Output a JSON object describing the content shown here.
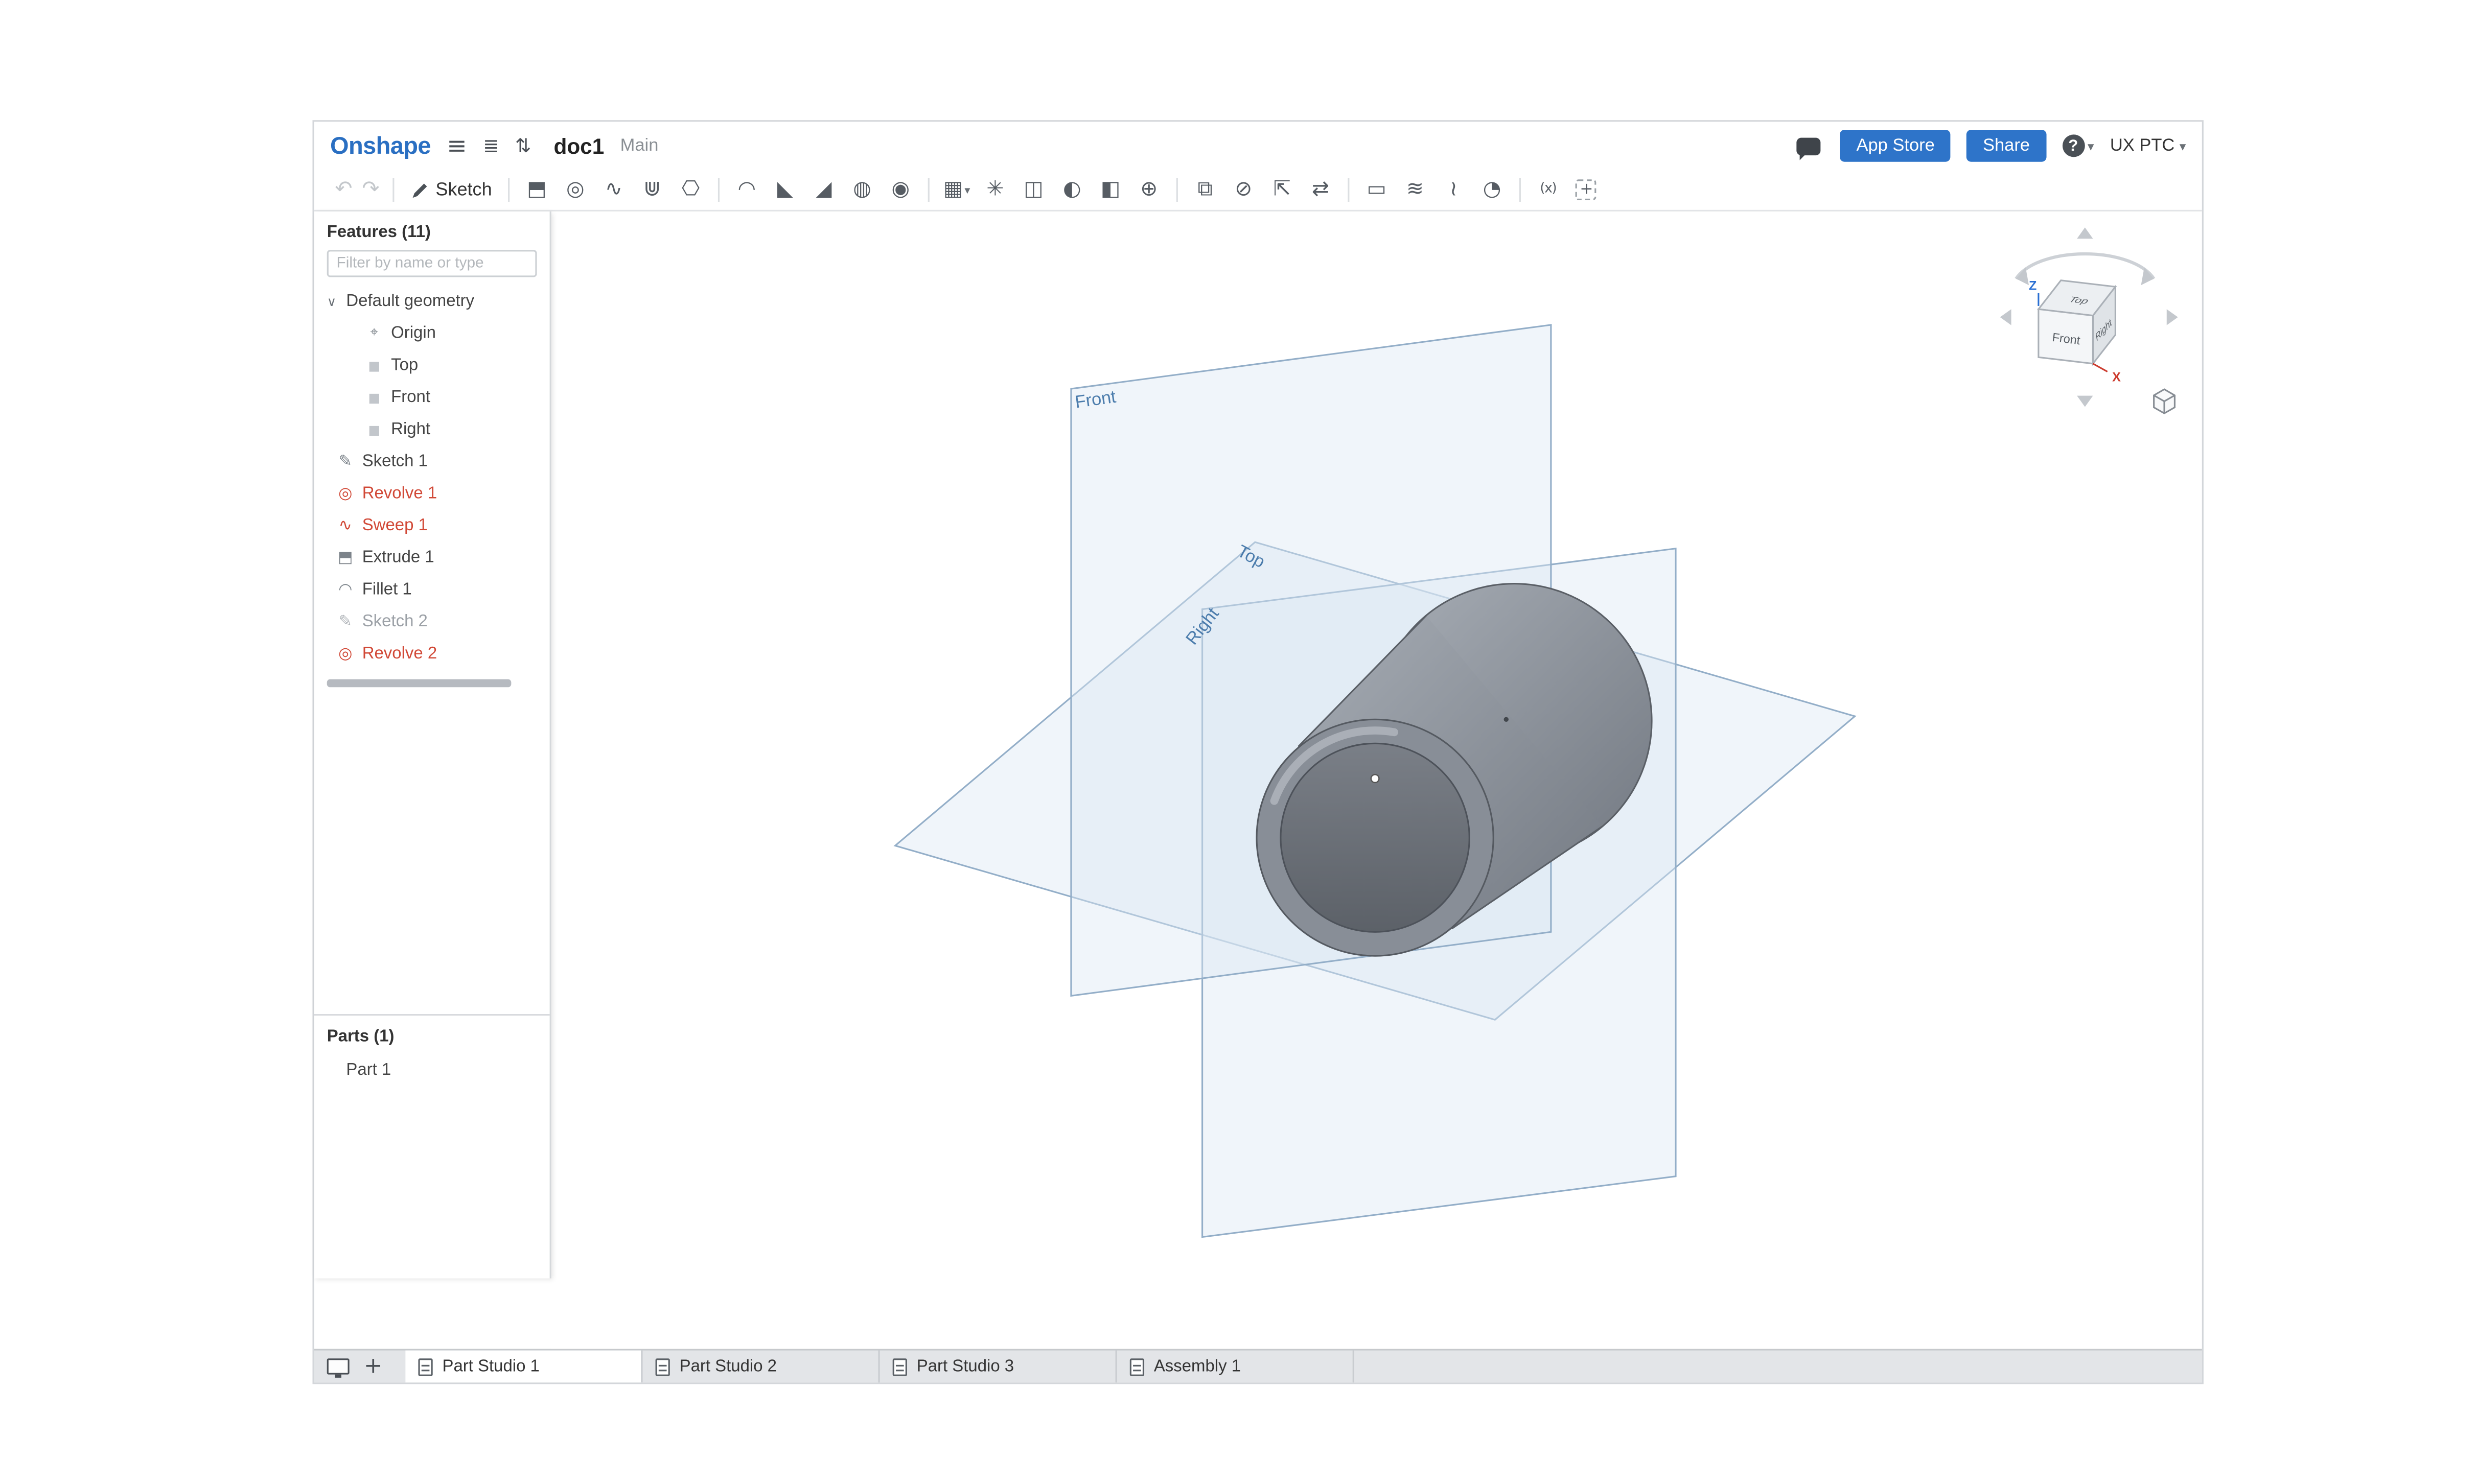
{
  "colors": {
    "brand_blue": "#2a6fc2",
    "button_blue": "#2e74c9",
    "error_red": "#d14836",
    "suppressed_gray": "#9ba0a6",
    "plane_label_blue": "#4b7cac",
    "axis_z_blue": "#2a6fd2",
    "axis_x_red": "#cc3b2e"
  },
  "glyphs": {
    "caret": "▾",
    "chevron_down": "∨",
    "menu": "≡",
    "versions": "≣",
    "follow": "⇅",
    "undo": "↶",
    "redo": "↷"
  },
  "topbar": {
    "logo": "Onshape",
    "document_title": "doc1",
    "workspace_name": "Main",
    "app_store_button": "App Store",
    "share_button": "Share",
    "help_label": "?",
    "account_menu": "UX PTC"
  },
  "toolbar": {
    "sketch_label": "Sketch",
    "icons": [
      {
        "name": "extrude-icon",
        "glyph": "⬒"
      },
      {
        "name": "revolve-icon",
        "glyph": "◎"
      },
      {
        "name": "sweep-icon",
        "glyph": "∿"
      },
      {
        "name": "loft-icon",
        "glyph": "⋓"
      },
      {
        "name": "thicken-icon",
        "glyph": "⎔"
      },
      {
        "divider": true
      },
      {
        "name": "fillet-icon",
        "glyph": "◠"
      },
      {
        "name": "chamfer-icon",
        "glyph": "◣"
      },
      {
        "name": "draft-icon",
        "glyph": "◢"
      },
      {
        "name": "shell-icon",
        "glyph": "◍"
      },
      {
        "name": "hole-icon",
        "glyph": "◉"
      },
      {
        "divider": true
      },
      {
        "name": "linear-pattern-icon",
        "glyph": "▦",
        "caret": true
      },
      {
        "name": "circular-pattern-icon",
        "glyph": "✳"
      },
      {
        "name": "mirror-icon",
        "glyph": "◫"
      },
      {
        "name": "boolean-icon",
        "glyph": "◐"
      },
      {
        "name": "split-icon",
        "glyph": "◧"
      },
      {
        "name": "transform-icon",
        "glyph": "⊕"
      },
      {
        "divider": true
      },
      {
        "name": "offset-surface-icon",
        "glyph": "⧉"
      },
      {
        "name": "delete-face-icon",
        "glyph": "⊘"
      },
      {
        "name": "move-face-icon",
        "glyph": "⇱"
      },
      {
        "name": "replace-face-icon",
        "glyph": "⇄"
      },
      {
        "divider": true
      },
      {
        "name": "plane-icon",
        "glyph": "▭"
      },
      {
        "name": "helix-icon",
        "glyph": "≋"
      },
      {
        "name": "curve-icon",
        "glyph": "≀"
      },
      {
        "name": "project-curve-icon",
        "glyph": "◔"
      },
      {
        "divider": true
      },
      {
        "name": "variable-icon",
        "glyph": "(x)",
        "small": true
      },
      {
        "name": "featurescript-icon",
        "glyph": "+",
        "boxed": true
      }
    ]
  },
  "features_panel": {
    "title": "Features (11)",
    "filter_placeholder": "Filter by name or type",
    "tree": [
      {
        "label": "Default geometry",
        "type": "group",
        "expander": true
      },
      {
        "label": "Origin",
        "type": "origin",
        "glyph": "⌖",
        "indent": 2
      },
      {
        "label": "Top",
        "type": "plane",
        "glyph": "■",
        "indent": 2
      },
      {
        "label": "Front",
        "type": "plane",
        "glyph": "■",
        "indent": 2
      },
      {
        "label": "Right",
        "type": "plane",
        "glyph": "■",
        "indent": 2
      },
      {
        "label": "Sketch 1",
        "type": "sketch",
        "glyph": "✎"
      },
      {
        "label": "Revolve 1",
        "type": "revolve",
        "glyph": "◎",
        "state": "error"
      },
      {
        "label": "Sweep 1",
        "type": "sweep",
        "glyph": "∿",
        "state": "error"
      },
      {
        "label": "Extrude 1",
        "type": "extrude",
        "glyph": "⬒"
      },
      {
        "label": "Fillet 1",
        "type": "fillet",
        "glyph": "◠"
      },
      {
        "label": "Sketch 2",
        "type": "sketch",
        "glyph": "✎",
        "state": "suppressed"
      },
      {
        "label": "Revolve 2",
        "type": "revolve",
        "glyph": "◎",
        "state": "error"
      }
    ]
  },
  "parts_panel": {
    "title": "Parts (1)",
    "items": [
      {
        "label": "Part 1"
      }
    ]
  },
  "viewport": {
    "plane_labels": {
      "front": "Front",
      "top": "Top",
      "right": "Right"
    },
    "view_cube": {
      "front": "Front",
      "top": "Top",
      "right": "Right",
      "axis_x": "X",
      "axis_z": "Z"
    }
  },
  "tabs_bar": {
    "new_tab_label": "+",
    "tabs": [
      {
        "label": "Part Studio 1",
        "icon": "part-studio-icon",
        "active": true
      },
      {
        "label": "Part Studio 2",
        "icon": "part-studio-icon",
        "active": false
      },
      {
        "label": "Part Studio 3",
        "icon": "part-studio-icon",
        "active": false
      },
      {
        "label": "Assembly 1",
        "icon": "assembly-icon",
        "active": false
      }
    ]
  }
}
